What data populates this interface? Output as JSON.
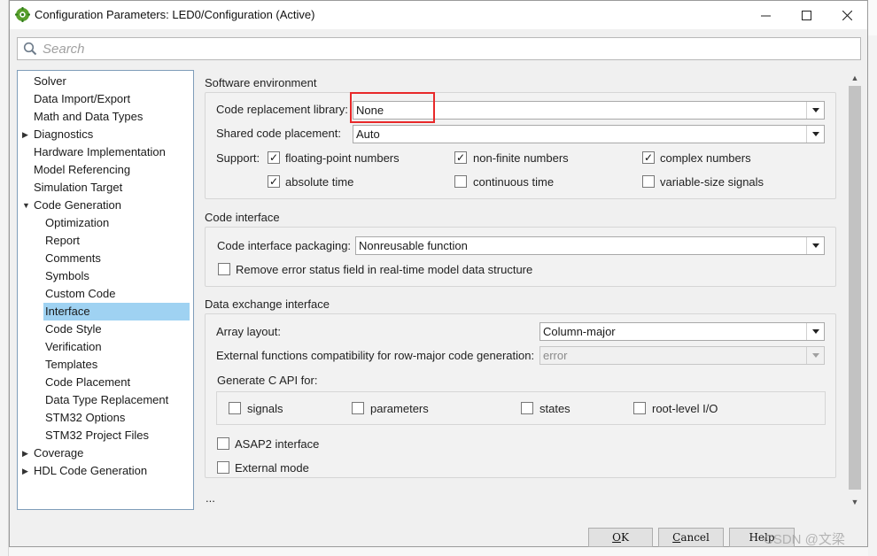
{
  "window": {
    "title": "Configuration Parameters: LED0/Configuration (Active)",
    "controls": {
      "minimize": "minimize-icon",
      "maximize": "maximize-icon",
      "close": "close-icon"
    }
  },
  "search": {
    "placeholder": "Search",
    "value": ""
  },
  "tree": {
    "items": [
      {
        "label": "Solver",
        "level": 0,
        "expander": ""
      },
      {
        "label": "Data Import/Export",
        "level": 0,
        "expander": ""
      },
      {
        "label": "Math and Data Types",
        "level": 0,
        "expander": ""
      },
      {
        "label": "Diagnostics",
        "level": 0,
        "expander": "collapsed"
      },
      {
        "label": "Hardware Implementation",
        "level": 0,
        "expander": ""
      },
      {
        "label": "Model Referencing",
        "level": 0,
        "expander": ""
      },
      {
        "label": "Simulation Target",
        "level": 0,
        "expander": ""
      },
      {
        "label": "Code Generation",
        "level": 0,
        "expander": "expanded"
      },
      {
        "label": "Optimization",
        "level": 1,
        "expander": ""
      },
      {
        "label": "Report",
        "level": 1,
        "expander": ""
      },
      {
        "label": "Comments",
        "level": 1,
        "expander": ""
      },
      {
        "label": "Symbols",
        "level": 1,
        "expander": ""
      },
      {
        "label": "Custom Code",
        "level": 1,
        "expander": ""
      },
      {
        "label": "Interface",
        "level": 1,
        "expander": "",
        "selected": true
      },
      {
        "label": "Code Style",
        "level": 1,
        "expander": ""
      },
      {
        "label": "Verification",
        "level": 1,
        "expander": ""
      },
      {
        "label": "Templates",
        "level": 1,
        "expander": ""
      },
      {
        "label": "Code Placement",
        "level": 1,
        "expander": ""
      },
      {
        "label": "Data Type Replacement",
        "level": 1,
        "expander": ""
      },
      {
        "label": "STM32 Options",
        "level": 1,
        "expander": ""
      },
      {
        "label": "STM32 Project Files",
        "level": 1,
        "expander": ""
      },
      {
        "label": "Coverage",
        "level": 0,
        "expander": "collapsed"
      },
      {
        "label": "HDL Code Generation",
        "level": 0,
        "expander": "collapsed"
      }
    ]
  },
  "software_env": {
    "title": "Software environment",
    "code_replacement_label": "Code replacement library:",
    "code_replacement_value": "None",
    "shared_code_label": "Shared code placement:",
    "shared_code_value": "Auto",
    "support_label": "Support:",
    "checks": {
      "floating_point": {
        "label": "floating-point numbers",
        "checked": true
      },
      "non_finite": {
        "label": "non-finite numbers",
        "checked": true
      },
      "complex": {
        "label": "complex numbers",
        "checked": true
      },
      "absolute_time": {
        "label": "absolute time",
        "checked": true
      },
      "continuous_time": {
        "label": "continuous time",
        "checked": false
      },
      "variable_size": {
        "label": "variable-size signals",
        "checked": false
      }
    }
  },
  "code_interface": {
    "title": "Code interface",
    "packaging_label": "Code interface packaging:",
    "packaging_value": "Nonreusable function",
    "remove_error_label": "Remove error status field in real-time model data structure",
    "remove_error_checked": false
  },
  "data_exchange": {
    "title": "Data exchange interface",
    "array_layout_label": "Array layout:",
    "array_layout_value": "Column-major",
    "ext_func_label": "External functions compatibility for row-major code generation:",
    "ext_func_value": "error",
    "gen_c_api_label": "Generate C API for:",
    "c_api": {
      "signals": {
        "label": "signals",
        "checked": false
      },
      "parameters": {
        "label": "parameters",
        "checked": false
      },
      "states": {
        "label": "states",
        "checked": false
      },
      "root_level_io": {
        "label": "root-level I/O",
        "checked": false
      }
    },
    "asap2_label": "ASAP2 interface",
    "asap2_checked": false,
    "external_mode_label": "External mode",
    "external_mode_checked": false
  },
  "more": "...",
  "buttons": {
    "ok_u": "O",
    "ok_rest": "K",
    "cancel_u": "C",
    "cancel_rest": "ancel",
    "help": "Help"
  },
  "watermark": "CSDN @文梁",
  "colors": {
    "selection": "#9fd2f2",
    "highlight_box": "#e8292a"
  }
}
